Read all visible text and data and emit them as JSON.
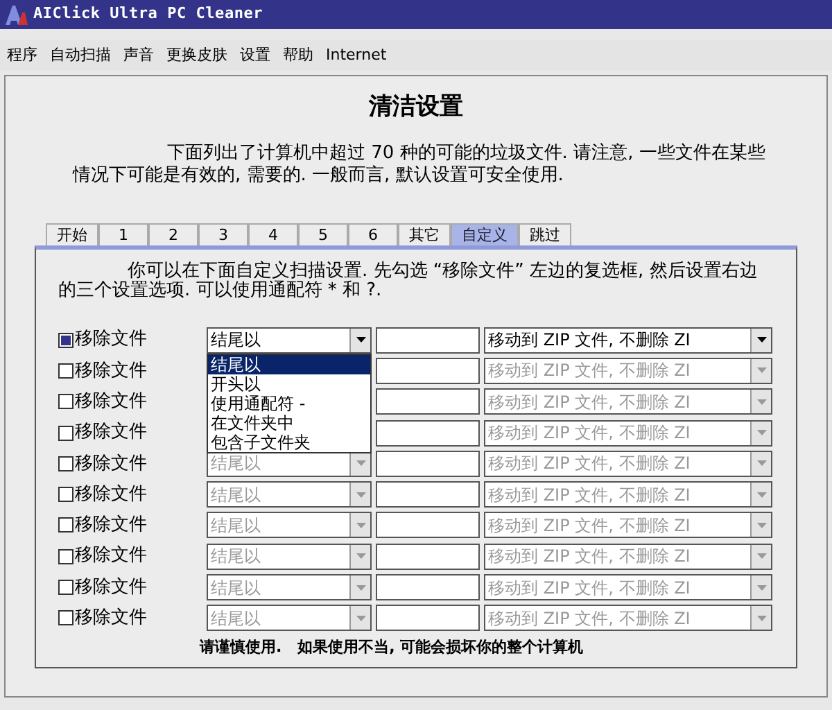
{
  "window": {
    "title": "AIClick Ultra PC Cleaner"
  },
  "menu": [
    "程序",
    "自动扫描",
    "声音",
    "更换皮肤",
    "设置",
    "帮助",
    "Internet"
  ],
  "heading": "清洁设置",
  "intro": "下面列出了计算机中超过 70 种的可能的垃圾文件.  请注意, 一些文件在某些情况下可能是有效的, 需要的.  一般而言, 默认设置可安全使用.",
  "tabs": [
    {
      "label": "开始",
      "selected": false
    },
    {
      "label": "1",
      "selected": false
    },
    {
      "label": "2",
      "selected": false
    },
    {
      "label": "3",
      "selected": false
    },
    {
      "label": "4",
      "selected": false
    },
    {
      "label": "5",
      "selected": false
    },
    {
      "label": "6",
      "selected": false
    },
    {
      "label": "其它",
      "selected": false
    },
    {
      "label": "自定义",
      "selected": true
    },
    {
      "label": "跳过",
      "selected": false
    }
  ],
  "instructions": "你可以在下面自定义扫描设置.  先勾选 “移除文件” 左边的复选框, 然后设置右边的三个设置选项. 可以使用通配符 * 和 ?.",
  "rows": [
    {
      "label": "移除文件",
      "checked": true,
      "disabled": false,
      "match": "结尾以",
      "action": "移动到 ZIP 文件, 不删除 ZI"
    },
    {
      "label": "移除文件",
      "checked": false,
      "disabled": true,
      "action": "移动到 ZIP 文件, 不删除 ZI"
    },
    {
      "label": "移除文件",
      "checked": false,
      "disabled": true,
      "action": "移动到 ZIP 文件, 不删除 ZI"
    },
    {
      "label": "移除文件",
      "checked": false,
      "disabled": true,
      "action": "移动到 ZIP 文件, 不删除 ZI"
    },
    {
      "label": "移除文件",
      "checked": false,
      "disabled": true,
      "match": "结尾以",
      "action": "移动到 ZIP 文件, 不删除 ZI"
    },
    {
      "label": "移除文件",
      "checked": false,
      "disabled": true,
      "match": "结尾以",
      "action": "移动到 ZIP 文件, 不删除 ZI"
    },
    {
      "label": "移除文件",
      "checked": false,
      "disabled": true,
      "match": "结尾以",
      "action": "移动到 ZIP 文件, 不删除 ZI"
    },
    {
      "label": "移除文件",
      "checked": false,
      "disabled": true,
      "match": "结尾以",
      "action": "移动到 ZIP 文件, 不删除 ZI"
    },
    {
      "label": "移除文件",
      "checked": false,
      "disabled": true,
      "match": "结尾以",
      "action": "移动到 ZIP 文件, 不删除 ZI"
    },
    {
      "label": "移除文件",
      "checked": false,
      "disabled": true,
      "match": "结尾以",
      "action": "移动到 ZIP 文件, 不删除 ZI"
    }
  ],
  "dropdown_list": [
    {
      "label": "结尾以",
      "selected": true
    },
    {
      "label": "开头以",
      "selected": false
    },
    {
      "label": "使用通配符 -",
      "selected": false
    },
    {
      "label": "在文件夹中",
      "selected": false
    },
    {
      "label": "包含子文件夹",
      "selected": false
    }
  ],
  "warning": "请谨慎使用.   如果使用不当, 可能会损坏你的整个计算机"
}
